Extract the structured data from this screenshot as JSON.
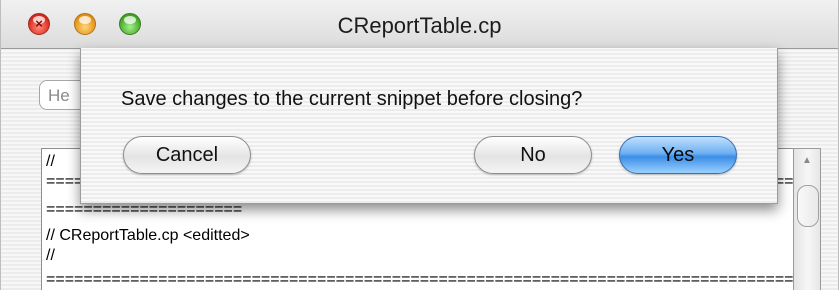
{
  "window": {
    "title": "CReportTable.cp"
  },
  "toolbar": {
    "field_text": "He"
  },
  "editor": {
    "lines": [
      "//",
      "==================================================================================",
      "=====================",
      "// CReportTable.cp <editted>",
      "//",
      "=================================================================================="
    ]
  },
  "dialog": {
    "message": "Save changes to the current snippet before closing?",
    "cancel_label": "Cancel",
    "no_label": "No",
    "yes_label": "Yes"
  },
  "colors": {
    "default_button": "#3b8ee6",
    "close": "#d9261b",
    "minimize": "#e58e12",
    "zoom": "#3ea41f"
  }
}
